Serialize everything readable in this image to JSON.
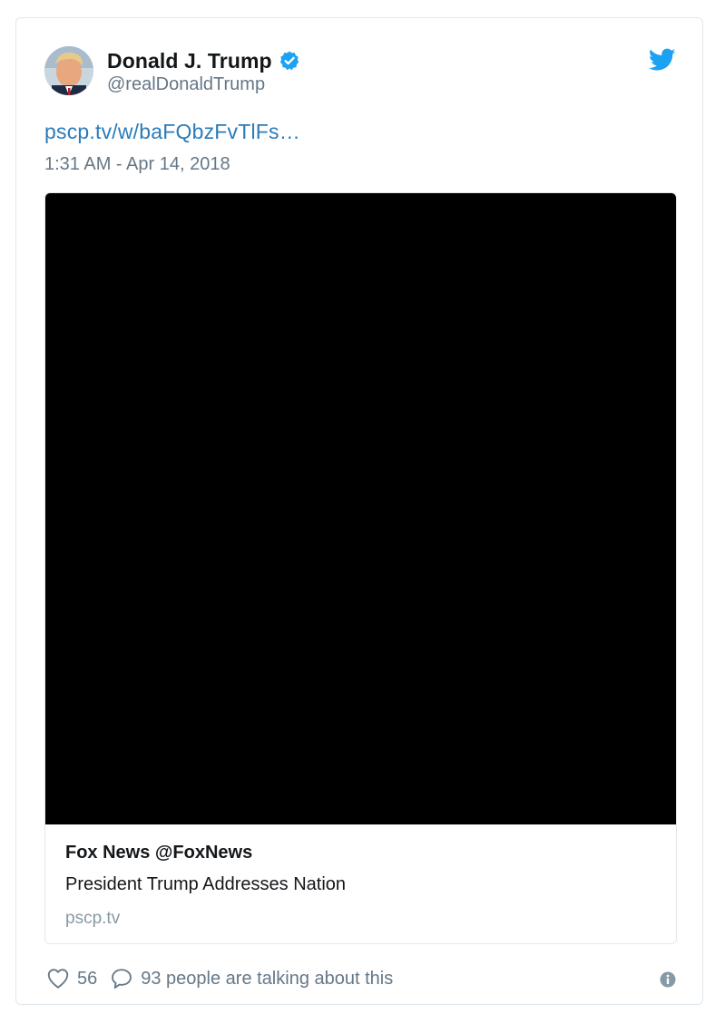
{
  "tweet": {
    "author_name": "Donald J. Trump",
    "author_handle": "@realDonaldTrump",
    "link_text": "pscp.tv/w/baFQbzFvTlFs…",
    "timestamp": "1:31 AM - Apr 14, 2018"
  },
  "media_card": {
    "title": "Fox News @FoxNews",
    "description": "President Trump Addresses Nation",
    "domain": "pscp.tv"
  },
  "footer": {
    "like_count": "56",
    "talking_text": "93 people are talking about this"
  },
  "icons": {
    "verified": "verified-badge-icon",
    "brand": "twitter-bird-icon",
    "like": "heart-icon",
    "reply": "speech-bubble-icon",
    "info": "info-icon"
  },
  "colors": {
    "twitter_blue": "#1da1f2",
    "link": "#2b7bb9",
    "secondary_text": "#657786",
    "video_bg": "#000000"
  }
}
